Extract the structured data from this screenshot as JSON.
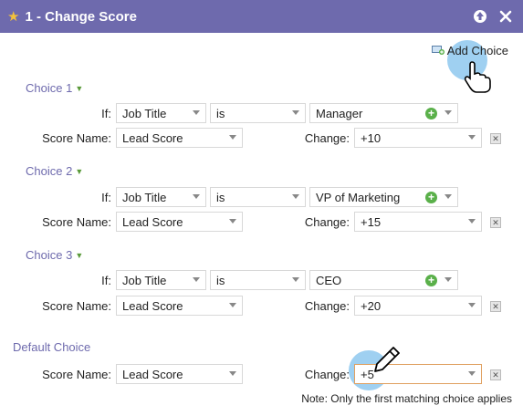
{
  "window": {
    "title": "1 - Change Score",
    "star_icon": "star-icon",
    "help_icon": "arrow-up-circle-icon",
    "close_icon": "close-icon"
  },
  "toolbar": {
    "add_choice_label": "Add Choice",
    "add_choice_icon": "add-choice-icon"
  },
  "labels": {
    "if": "If:",
    "score_name": "Score Name:",
    "change": "Change:"
  },
  "choices": [
    {
      "heading": "Choice 1",
      "field": "Job Title",
      "operator": "is",
      "value": "Manager",
      "score_name": "Lead Score",
      "change": "+10"
    },
    {
      "heading": "Choice 2",
      "field": "Job Title",
      "operator": "is",
      "value": "VP of Marketing",
      "score_name": "Lead Score",
      "change": "+15"
    },
    {
      "heading": "Choice 3",
      "field": "Job Title",
      "operator": "is",
      "value": "CEO",
      "score_name": "Lead Score",
      "change": "+20"
    }
  ],
  "default_choice": {
    "heading": "Default Choice",
    "score_name": "Lead Score",
    "change": "+5"
  },
  "note": "Note: Only the first matching choice applies",
  "colors": {
    "titlebar": "#6e6aad",
    "accent": "#6e6aad",
    "plus": "#5ab04a",
    "cursor_glow": "#50aae6"
  }
}
